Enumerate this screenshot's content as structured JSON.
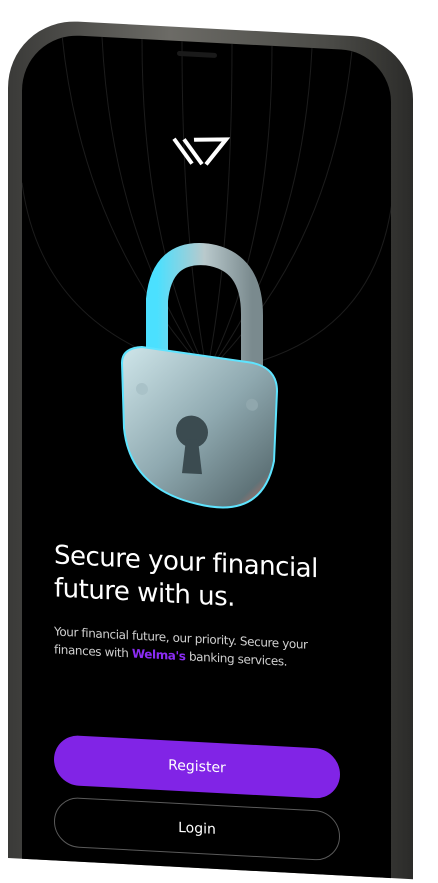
{
  "logo_icon": "welma-logo-icon",
  "hero": {
    "image": "padlock-icon"
  },
  "headline": "Secure your financial future with us.",
  "subtitle": {
    "before": "Your financial future, our priority. Secure your finances with ",
    "brand": "Welma's",
    "after": " banking services."
  },
  "buttons": {
    "register": "Register",
    "login": "Login"
  },
  "colors": {
    "accent": "#8124e6",
    "background": "#000000"
  }
}
